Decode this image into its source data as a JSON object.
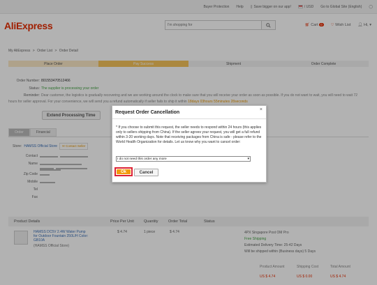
{
  "topbar": {
    "buyer_protection": "Buyer Protection",
    "help": "Help",
    "save_app": "Save bigger on our app!",
    "ship_to": "/ USD",
    "wholesale": "Go to Global Site (English)"
  },
  "header": {
    "logo": "AliExpress",
    "search_placeholder": "I'm shopping for",
    "cart_label": "Cart",
    "cart_count": "0",
    "wishlist_label": "Wish List",
    "greeting": "Hi,"
  },
  "breadcrumb": {
    "home": "My AliExpress",
    "sep1": ">",
    "list": "Order List",
    "sep2": ">",
    "current": "Order Detail"
  },
  "steps": [
    "Place Order",
    "Pay Success",
    "Shipment",
    "Order Complete"
  ],
  "order_info": {
    "order_number_label": "Order Number:",
    "order_number": "801553470512466",
    "status_label": "Status:",
    "status": "The supplier is processing your order",
    "reminder_label": "Reminder:",
    "reminder_text": "Dear customer, the logistics is gradually recovering and we are working around the clock to make sure that you will receive your order as soon as possible. If you do not want to wait, you will need to wait 72 hours for seller approval. For your convenience, we will send you a refund automatically if seller fails to ship it within",
    "reminder_extra": "18days 03hours 55minutes 28seconds"
  },
  "buttons": {
    "extend": "Extend Processing Time"
  },
  "tabs": [
    "Order",
    "Financial"
  ],
  "store": {
    "label": "Store:",
    "name": "HAMSS Official Store",
    "contact": "Contact Seller"
  },
  "address_labels": [
    "Contact",
    "Name",
    "Zip Code",
    "Mobile",
    "Tel",
    "Fax"
  ],
  "table": {
    "headers": [
      "Product Details",
      "Price Per Unit",
      "Quantity",
      "Order Total",
      "Status"
    ],
    "product": {
      "title": "HAMSS DC5V 2.4W Water Pump for Outdoor Fountain 250L/H Color: GB10A",
      "store": "(HAMSS Official Store)",
      "price": "$ 4.74",
      "quantity": "1 piece",
      "total": "$ 4.74",
      "ship_method": "4PX Singapore Post OM Pro",
      "free_shipping": "Free Shipping",
      "delivery": "Estimated Delivery Time: 25-42 Days",
      "ship_within": "Will be shipped within (Business days) 5 Days"
    }
  },
  "totals": {
    "headers": [
      "Product Amount",
      "Shipping Cost",
      "Total Amount"
    ],
    "values": [
      "US $ 4.74",
      "US $ 0.00",
      "US $ 4.74"
    ]
  },
  "dialog": {
    "title": "Request Order Cancellation",
    "close": "×",
    "message": "* If you choose to submit this request, the seller needs to respond within 24 hours (this applies only to sellers shipping from China). If the seller agrees your request, you will get a full refund within 3-20 working days. Note that receiving packages from China is safe - please refer to the World Health Organization for details. Let us know why you want to cancel order:",
    "reason_selected": "I do not need this order any more",
    "ok": "Ok",
    "cancel": "Cancel"
  }
}
